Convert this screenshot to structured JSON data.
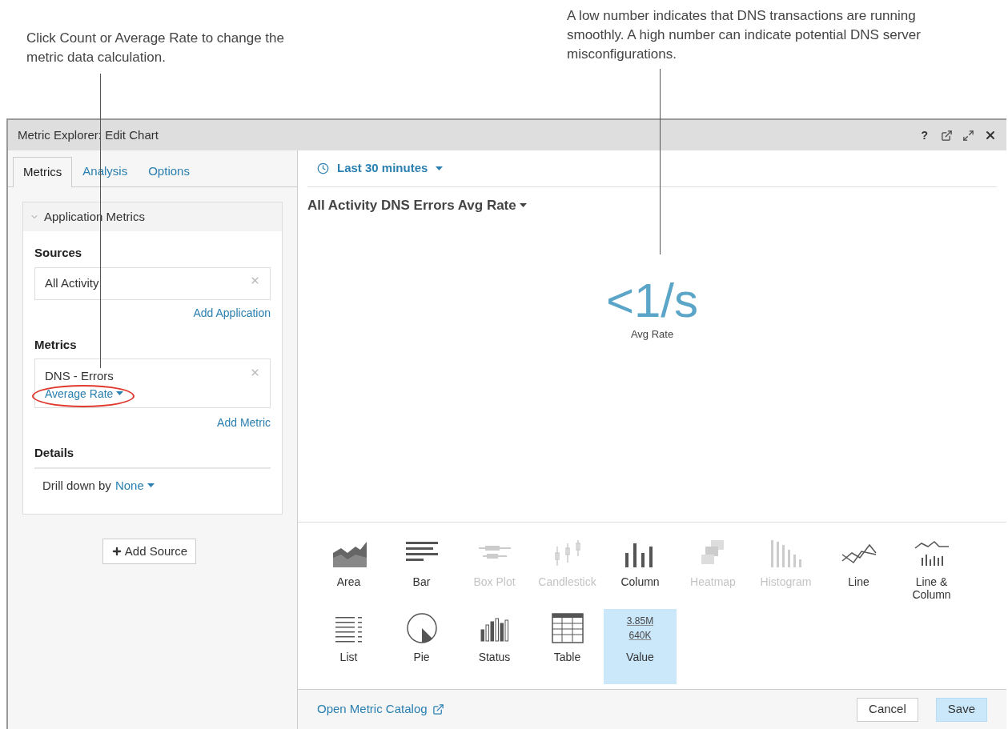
{
  "callouts": [
    {
      "text": "Click Count or Average Rate to change the metric data calculation."
    },
    {
      "text": "A low number indicates that DNS transactions are running smoothly. A high number can indicate potential DNS server misconfigurations."
    }
  ],
  "window": {
    "title": "Metric Explorer: Edit Chart",
    "help": "?"
  },
  "tabs": [
    {
      "label": "Metrics",
      "selected": true
    },
    {
      "label": "Analysis",
      "selected": false
    },
    {
      "label": "Options",
      "selected": false
    }
  ],
  "section": {
    "title": "Application Metrics",
    "expanded": true,
    "sources": {
      "label": "Sources",
      "value": "All Activity",
      "add": "Add Application"
    },
    "metrics": {
      "label": "Metrics",
      "value": "DNS - Errors",
      "calculation": "Average Rate",
      "add": "Add Metric",
      "highlighted": true
    },
    "details": {
      "label": "Details",
      "drill_label": "Drill down by",
      "drill_value": "None"
    }
  },
  "add_source": "Add Source",
  "time_range": "Last 30 minutes",
  "chart_title": "All Activity DNS Errors Avg Rate",
  "value": {
    "number": "<1/s",
    "caption": "Avg Rate"
  },
  "chart_types": [
    {
      "kind": "area",
      "label": "Area",
      "disabled": false,
      "selected": false
    },
    {
      "kind": "bar",
      "label": "Bar",
      "disabled": false,
      "selected": false
    },
    {
      "kind": "boxplot",
      "label": "Box Plot",
      "disabled": true,
      "selected": false
    },
    {
      "kind": "candlestick",
      "label": "Candlestick",
      "disabled": true,
      "selected": false
    },
    {
      "kind": "column",
      "label": "Column",
      "disabled": false,
      "selected": false
    },
    {
      "kind": "heatmap",
      "label": "Heatmap",
      "disabled": true,
      "selected": false
    },
    {
      "kind": "histogram",
      "label": "Histogram",
      "disabled": true,
      "selected": false
    },
    {
      "kind": "line",
      "label": "Line",
      "disabled": false,
      "selected": false
    },
    {
      "kind": "linecolumn",
      "label": "Line & Column",
      "disabled": false,
      "selected": false
    },
    {
      "kind": "list",
      "label": "List",
      "disabled": false,
      "selected": false
    },
    {
      "kind": "pie",
      "label": "Pie",
      "disabled": false,
      "selected": false
    },
    {
      "kind": "status",
      "label": "Status",
      "disabled": false,
      "selected": false
    },
    {
      "kind": "table",
      "label": "Table",
      "disabled": false,
      "selected": false
    },
    {
      "kind": "value",
      "label": "Value",
      "disabled": false,
      "selected": true,
      "sample_values": [
        "3.85M",
        "640K"
      ]
    }
  ],
  "footer": {
    "catalog_link": "Open Metric Catalog",
    "buttons": [
      {
        "label": "Cancel",
        "primary": false
      },
      {
        "label": "Save",
        "primary": true
      }
    ]
  }
}
